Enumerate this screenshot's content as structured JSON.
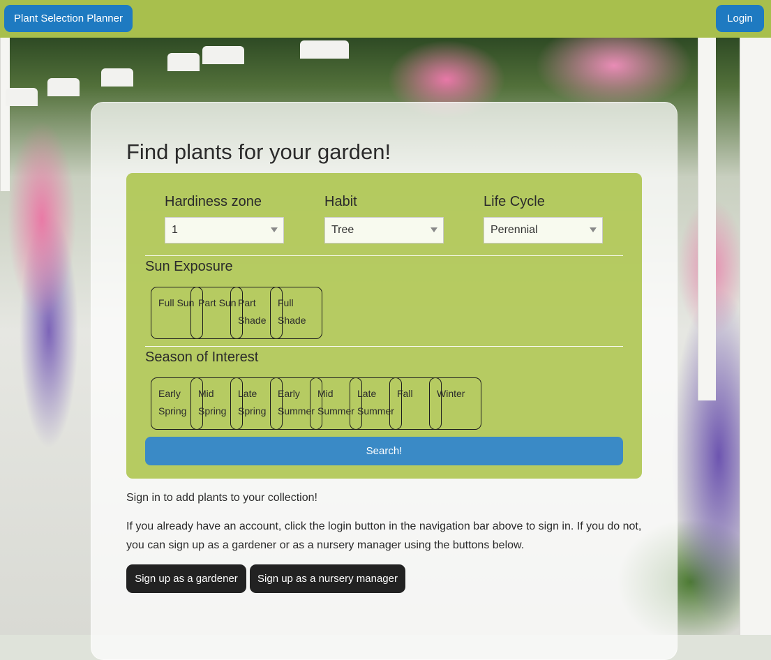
{
  "nav": {
    "brand": "Plant Selection Planner",
    "login": "Login"
  },
  "main": {
    "title": "Find plants for your garden!",
    "fields": {
      "hardiness": {
        "label": "Hardiness zone",
        "value": "1"
      },
      "habit": {
        "label": "Habit",
        "value": "Tree"
      },
      "life_cycle": {
        "label": "Life Cycle",
        "value": "Perennial"
      }
    },
    "sun_exposure": {
      "label": "Sun Exposure",
      "options": [
        "Full Sun",
        "Part Sun",
        "Part Shade",
        "Full Shade"
      ]
    },
    "season": {
      "label": "Season of Interest",
      "options": [
        "Early Spring",
        "Mid Spring",
        "Late Spring",
        "Early Summer",
        "Mid Summer",
        "Late Summer",
        "Fall",
        "Winter"
      ]
    },
    "search_label": "Search!",
    "signin_prompt": "Sign in to add plants to your collection!",
    "signin_info": "If you already have an account, click the login button in the navigation bar above to sign in. If you do not, you can sign up as a gardener or as a nursery manager using the buttons below.",
    "signup_gardener": "Sign up as a gardener",
    "signup_nursery": "Sign up as a nursery manager"
  },
  "colors": {
    "navbar": "#a8bf4d",
    "primary_button": "#1e7ac1",
    "panel": "#9cba28",
    "dark_button": "#222222"
  }
}
